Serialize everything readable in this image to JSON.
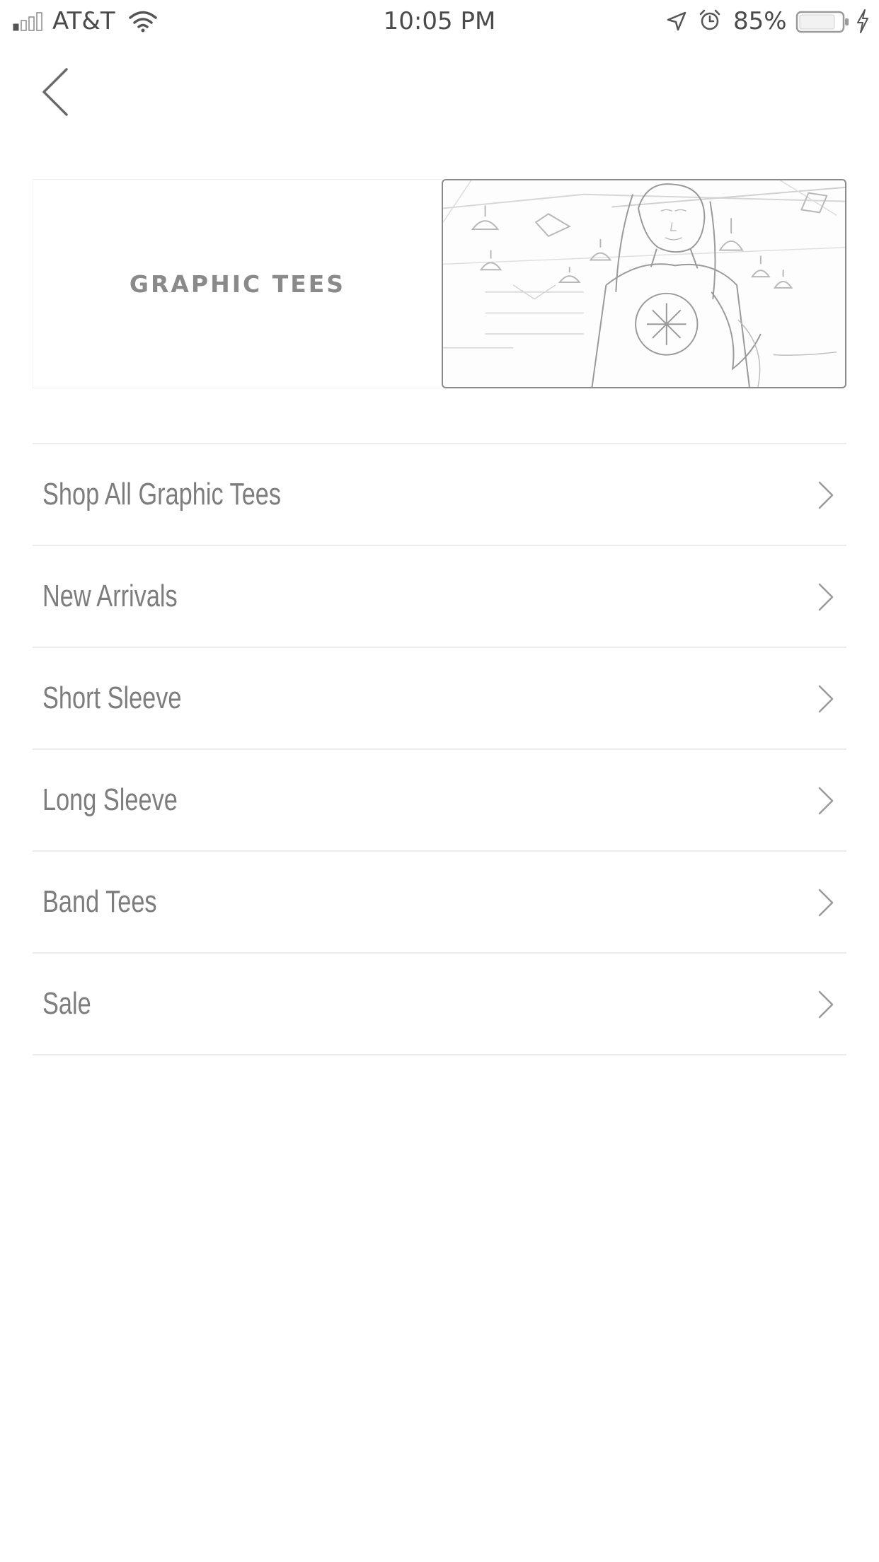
{
  "status_bar": {
    "carrier": "AT&T",
    "time": "10:05 PM",
    "battery_percent": "85%",
    "signal_bars_filled": 1,
    "battery_level": 0.85
  },
  "nav": {
    "back_icon": "chevron-left-icon"
  },
  "banner": {
    "title": "GRAPHIC TEES",
    "image_description_icon": "model-photo"
  },
  "menu": {
    "items": [
      {
        "label": "Shop All Graphic Tees",
        "icon": "chevron-right-icon"
      },
      {
        "label": "New Arrivals",
        "icon": "chevron-right-icon"
      },
      {
        "label": "Short Sleeve",
        "icon": "chevron-right-icon"
      },
      {
        "label": "Long Sleeve",
        "icon": "chevron-right-icon"
      },
      {
        "label": "Band Tees",
        "icon": "chevron-right-icon"
      },
      {
        "label": "Sale",
        "icon": "chevron-right-icon"
      }
    ]
  },
  "colors": {
    "text": "#7d7d7d",
    "divider": "#ececec",
    "icon": "#9a9a9a",
    "background": "#ffffff"
  }
}
